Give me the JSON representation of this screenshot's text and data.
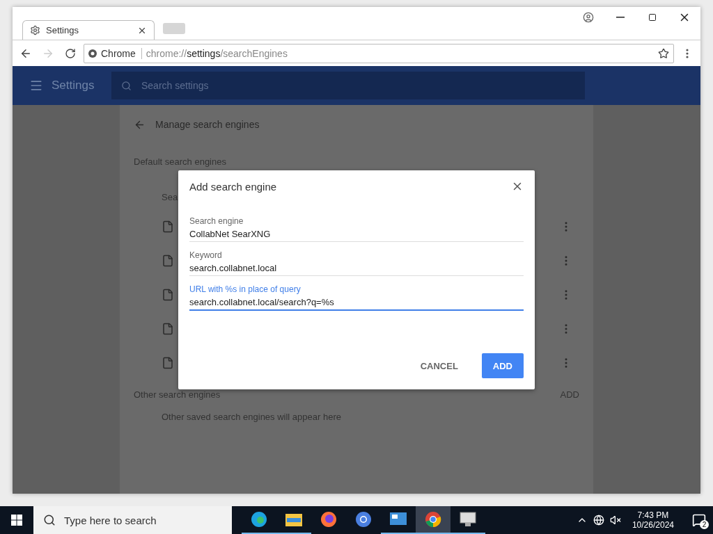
{
  "browser": {
    "tab": {
      "title": "Settings",
      "selected": true
    },
    "address": {
      "chip": "Chrome",
      "scheme": "chrome://",
      "host": "settings",
      "path": "/searchEngines"
    }
  },
  "settings_header": {
    "title": "Settings",
    "search": {
      "placeholder": "Search settings"
    }
  },
  "page": {
    "title": "Manage search engines",
    "default_section": "Default search engines",
    "column_heading": "Sea",
    "other_section": "Other search engines",
    "other_add": "ADD",
    "empty_note": "Other saved search engines will appear here"
  },
  "dialog": {
    "title": "Add search engine",
    "fields": [
      {
        "label": "Search engine",
        "value": "CollabNet SearXNG",
        "focused": false
      },
      {
        "label": "Keyword",
        "value": "search.collabnet.local",
        "focused": false
      },
      {
        "label": "URL with %s in place of query",
        "value": "search.collabnet.local/search?q=%s",
        "focused": true
      }
    ],
    "buttons": [
      {
        "label": "CANCEL",
        "kind": "text"
      },
      {
        "label": "ADD",
        "kind": "primary"
      }
    ]
  },
  "taskbar": {
    "search": {
      "placeholder": "Type here to search"
    },
    "apps": [
      {
        "kind": "edge",
        "running": true,
        "selected": false
      },
      {
        "kind": "folder",
        "running": true,
        "selected": false
      },
      {
        "kind": "firefox",
        "running": false,
        "selected": false
      },
      {
        "kind": "chromium",
        "running": false,
        "selected": false
      },
      {
        "kind": "remote",
        "running": true,
        "selected": false
      },
      {
        "kind": "chrome",
        "running": true,
        "selected": true
      },
      {
        "kind": "monitor",
        "running": true,
        "selected": false
      }
    ],
    "time": "7:43 PM",
    "date": "10/26/2024",
    "notifications": "2"
  }
}
